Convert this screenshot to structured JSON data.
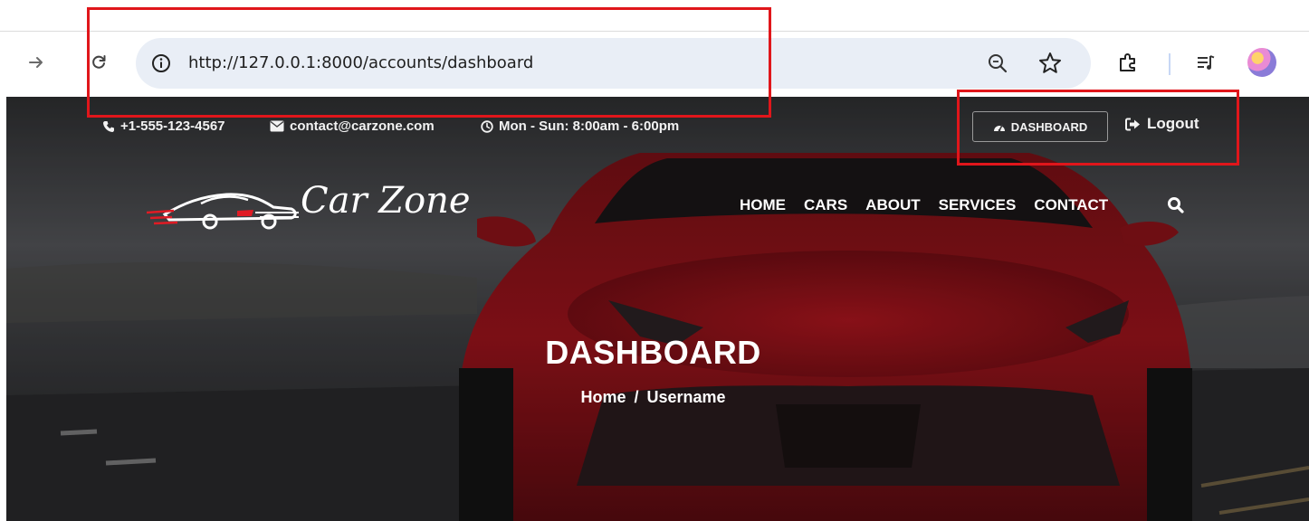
{
  "browser": {
    "url": "http://127.0.0.1:8000/accounts/dashboard",
    "icons": [
      "forward-arrow-icon",
      "reload-icon",
      "site-info-icon",
      "zoom-icon",
      "bookmark-star-icon",
      "extensions-icon",
      "media-controls-icon",
      "profile-avatar"
    ]
  },
  "topbar": {
    "phone": "+1-555-123-4567",
    "email": "contact@carzone.com",
    "hours": "Mon - Sun: 8:00am - 6:00pm",
    "dashboard_label": "DASHBOARD",
    "logout_label": "Logout"
  },
  "brand": {
    "name": "Car Zone"
  },
  "nav": {
    "items": [
      "HOME",
      "CARS",
      "ABOUT",
      "SERVICES",
      "CONTACT"
    ]
  },
  "hero": {
    "title": "DASHBOARD",
    "breadcrumb": {
      "home": "Home",
      "separator": "/",
      "current": "Username"
    }
  },
  "colors": {
    "annotation": "#e0161b",
    "car_red": "#a3141c",
    "omnibox_bg": "#e9eef6"
  }
}
